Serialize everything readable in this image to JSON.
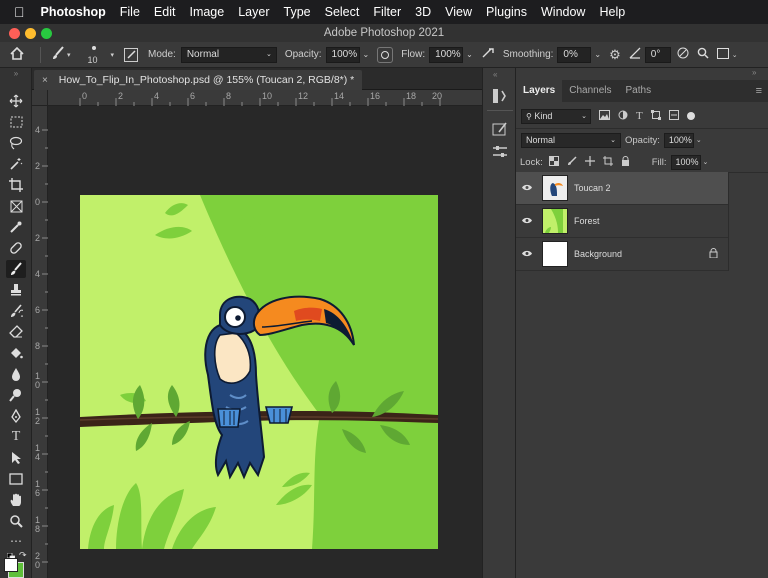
{
  "menubar": {
    "apple": "",
    "app": "Photoshop",
    "items": [
      "File",
      "Edit",
      "Image",
      "Layer",
      "Type",
      "Select",
      "Filter",
      "3D",
      "View",
      "Plugins",
      "Window",
      "Help"
    ]
  },
  "window": {
    "title": "Adobe Photoshop 2021"
  },
  "options": {
    "brush_size": "10",
    "mode_label": "Mode:",
    "mode_value": "Normal",
    "opacity_label": "Opacity:",
    "opacity_value": "100%",
    "flow_label": "Flow:",
    "flow_value": "100%",
    "smoothing_label": "Smoothing:",
    "smoothing_value": "0%",
    "angle_value": "0°"
  },
  "document": {
    "tab_title": "How_To_Flip_In_Photoshop.psd @ 155% (Toucan 2, RGB/8*) *"
  },
  "rulers": {
    "h": [
      "0",
      "2",
      "4",
      "6",
      "8",
      "10",
      "12",
      "14",
      "16",
      "18",
      "20"
    ],
    "v": [
      "4",
      "2",
      "0",
      "2",
      "4",
      "6",
      "8",
      "1\n0",
      "1\n2",
      "1\n4",
      "1\n6",
      "1\n8",
      "2\n0"
    ]
  },
  "layers_panel": {
    "tabs": [
      "Layers",
      "Channels",
      "Paths"
    ],
    "filter_kind": "Kind",
    "blend_mode": "Normal",
    "opacity_label": "Opacity:",
    "opacity_value": "100%",
    "lock_label": "Lock:",
    "fill_label": "Fill:",
    "fill_value": "100%",
    "layers": [
      {
        "name": "Toucan 2",
        "selected": true
      },
      {
        "name": "Forest",
        "selected": false
      },
      {
        "name": "Background",
        "selected": false,
        "locked": true
      }
    ]
  },
  "colors": {
    "canvas_bg": "#c1f06a",
    "trees": "#7ed03c",
    "toucan_body": "#23467a",
    "beak": "#f58a1f",
    "foreground_swatch": "#ffffff",
    "background_swatch": "#5fc03a"
  }
}
